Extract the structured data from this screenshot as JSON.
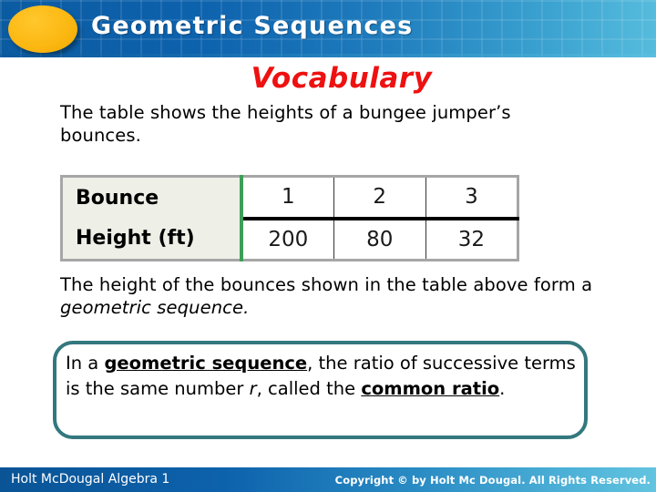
{
  "header": {
    "title": "Geometric Sequences",
    "ellipse_color": "#fcb813",
    "banner_color_start": "#0b5ba1",
    "banner_color_end": "#56bcdd"
  },
  "vocabulary": {
    "heading": "Vocabulary",
    "heading_color": "#ee1111"
  },
  "body": {
    "intro_paragraph": "The table shows the heights of a bungee jumper’s bounces.",
    "followup_prefix": "The height of the bounces shown in the table above form a ",
    "followup_italic": "geometric sequence."
  },
  "table": {
    "row_labels": [
      "Bounce",
      "Height (ft)"
    ],
    "rows": [
      {
        "label": "Bounce",
        "values": [
          "1",
          "2",
          "3"
        ]
      },
      {
        "label": "Height (ft)",
        "values": [
          "200",
          "80",
          "32"
        ]
      }
    ],
    "label_cell_bg": "#eef0e7",
    "accent_divider_color": "#3f9e57",
    "outer_border_color": "#a6a6a6"
  },
  "callout": {
    "border_color": "#33787e",
    "segment_1": "In a ",
    "term_1": "geometric sequence",
    "segment_2": ", the ratio of successive terms is the same number ",
    "variable": "r",
    "segment_3": ", called the ",
    "term_2": "common ratio",
    "segment_4": "."
  },
  "footer": {
    "left_text": "Holt McDougal Algebra 1",
    "copyright_text": "Copyright © by Holt Mc Dougal. All Rights Reserved."
  }
}
